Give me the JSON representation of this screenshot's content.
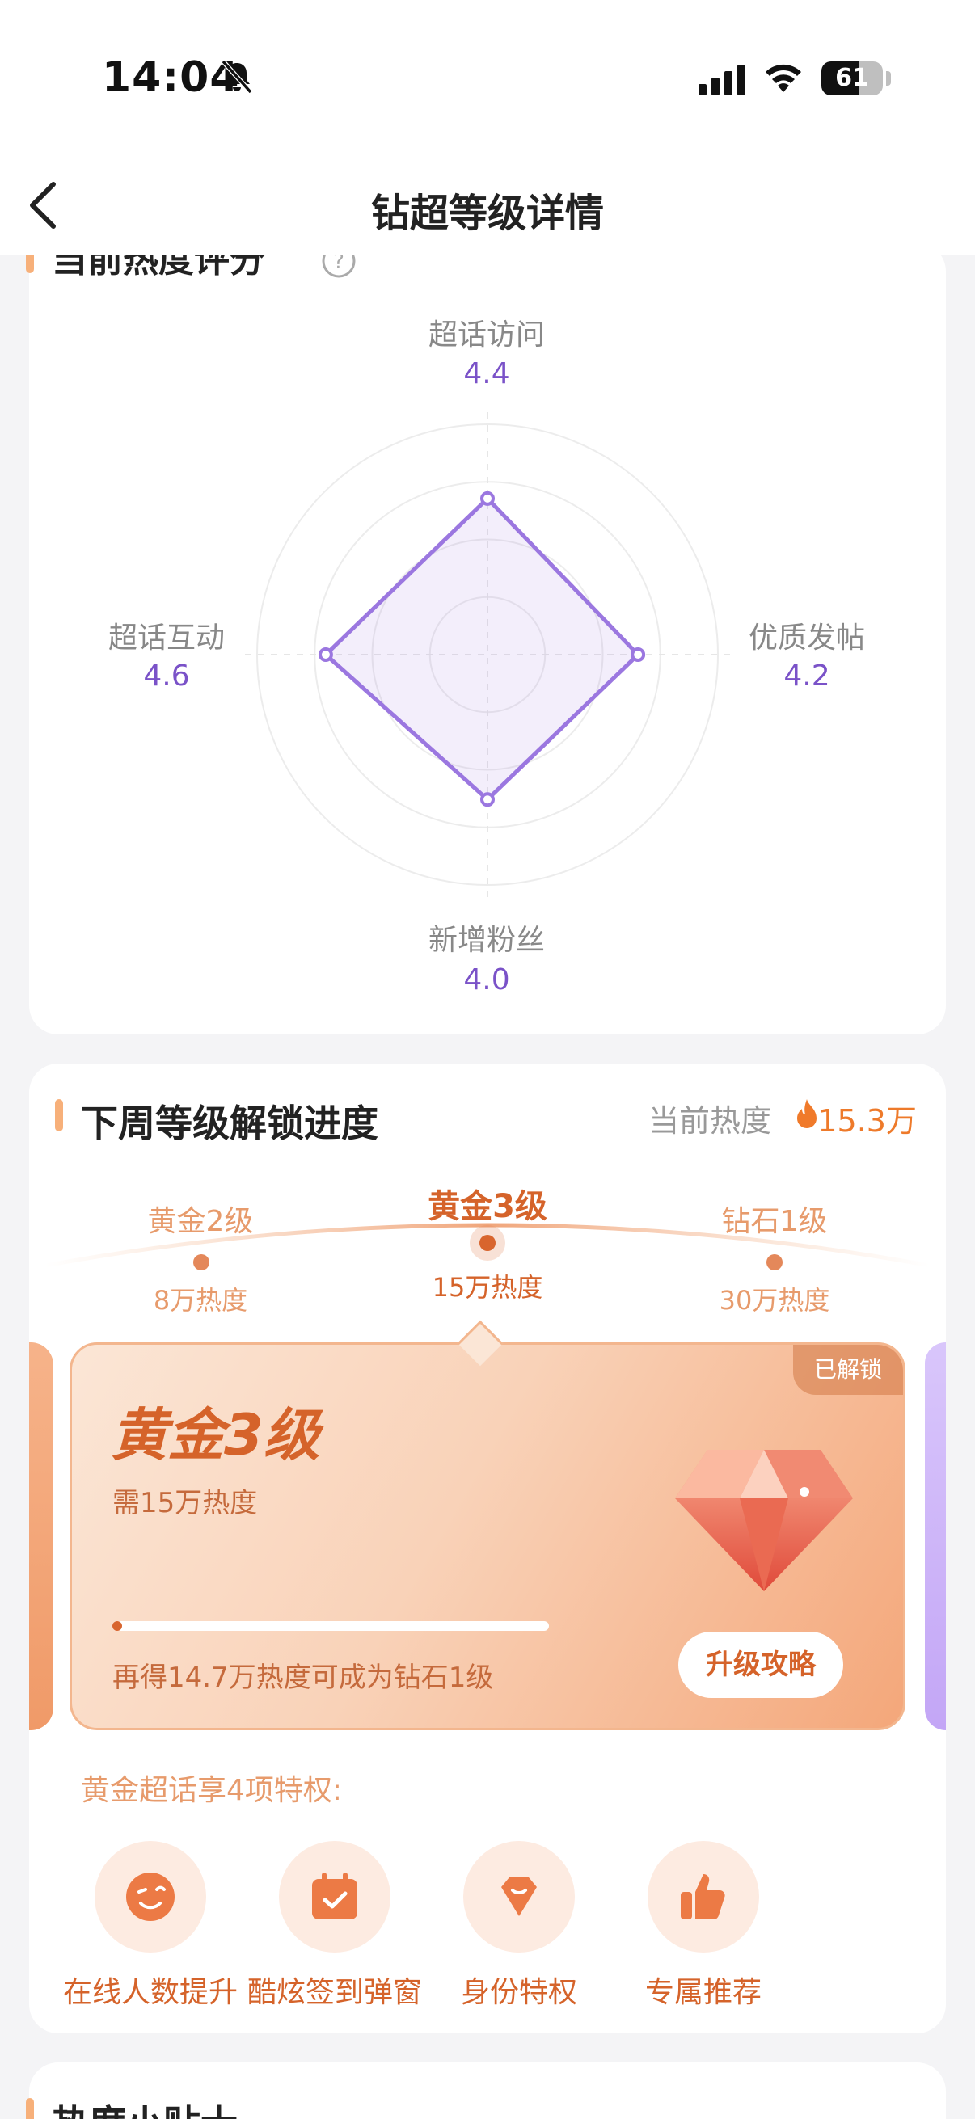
{
  "status_bar": {
    "time": "14:04",
    "battery": "61"
  },
  "nav": {
    "title": "钻超等级详情"
  },
  "score_section": {
    "title": "当前热度评分",
    "radar": {
      "axes": [
        {
          "label": "超话访问",
          "value": "4.4"
        },
        {
          "label": "优质发帖",
          "value": "4.2"
        },
        {
          "label": "新增粉丝",
          "value": "4.0"
        },
        {
          "label": "超话互动",
          "value": "4.6"
        }
      ],
      "max": 5
    }
  },
  "progress_section": {
    "title": "下周等级解锁进度",
    "current_heat_label": "当前热度",
    "current_heat_value": "15.3万",
    "levels": [
      {
        "name": "黄金2级",
        "heat": "8万热度"
      },
      {
        "name": "黄金3级",
        "heat": "15万热度"
      },
      {
        "name": "钻石1级",
        "heat": "30万热度"
      }
    ],
    "level_card": {
      "badge": "已解锁",
      "title": "黄金3级",
      "requirement": "需15万热度",
      "progress": 0.01,
      "hint": "再得14.7万热度可成为钻石1级",
      "button": "升级攻略"
    },
    "privileges_title": "黄金超话享4项特权:",
    "privileges": [
      {
        "label": "在线人数提升",
        "icon": "smile-face-icon"
      },
      {
        "label": "酷炫签到弹窗",
        "icon": "calendar-check-icon"
      },
      {
        "label": "身份特权",
        "icon": "gem-badge-icon"
      },
      {
        "label": "专属推荐",
        "icon": "thumbs-up-icon"
      }
    ]
  },
  "tips_section": {
    "title": "热度小贴士"
  },
  "colors": {
    "accent": "#d5632a",
    "radar": "#9b77e0",
    "value": "#7a52c8"
  }
}
